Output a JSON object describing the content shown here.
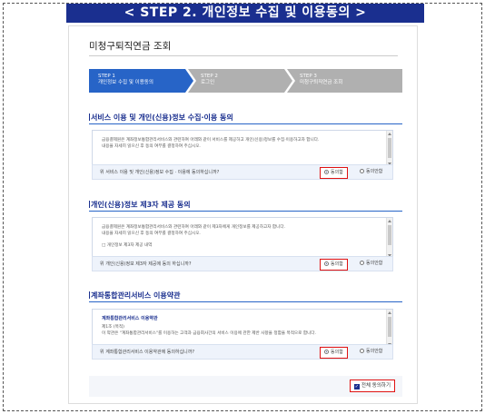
{
  "banner": "< STEP 2. 개인정보 수집 및 이용동의 >",
  "page_title": "미청구퇴직연금 조회",
  "steps": [
    {
      "num": "STEP 1",
      "label": "개인정보 수집 및 이용동의",
      "active": true
    },
    {
      "num": "STEP 2",
      "label": "로그인",
      "active": false
    },
    {
      "num": "STEP 3",
      "label": "미청구퇴직연금 조회",
      "active": false
    }
  ],
  "sections": [
    {
      "title": "서비스 이용 및 개인(신용)정보 수집·이용 동의",
      "lines": [
        "금융결제원은 계좌정보통합관리서비스와 관련하여 아래와 같이 서비스를 제공하고 개인(신용)정보를 수집·이용하고자 합니다.",
        "내용을 자세히 읽으신 후 동의 여부를 결정하여 주십시오."
      ],
      "question": "위 서비스 이용 및 개인(신용)정보 수집 · 이용에 동의하십니까?",
      "agree_label": "동의함",
      "disagree_label": "동의안함"
    },
    {
      "title": "개인(신용)정보 제3자 제공 동의",
      "lines": [
        "금융결제원은 계좌정보통합관리서비스와 관련하여 아래와 같이 제3자에게 개인정보를 제공하고자 합니다.",
        "내용을 자세히 읽으신 후 동의 여부를 결정하여 주십시오."
      ],
      "list_item": "□ 개인정보 제3자 제공 내역",
      "question": "위 개인(신용)정보 제3자 제공에 동의 하십니까?",
      "agree_label": "동의함",
      "disagree_label": "동의안함"
    },
    {
      "title": "계좌통합관리서비스 이용약관",
      "box_title": "계좌통합관리서비스 이용약관",
      "lines": [
        "제1조 (목적)",
        "이 약관은 \"계좌통합관리서비스\"를 이용하는 고객과 금융회사간의 서비스 이용에 관한 제반 사항을 정함을 목적으로 합니다."
      ],
      "question": "위 계좌통합관리서비스 이용약관에 동의하십니까?",
      "agree_label": "동의함",
      "disagree_label": "동의안함"
    }
  ],
  "all_agree_label": "전체 동의하기",
  "colors": {
    "navy": "#1a2f8f",
    "step_active": "#2764c7",
    "step_inactive": "#b0b0b0",
    "highlight": "#e01212"
  }
}
